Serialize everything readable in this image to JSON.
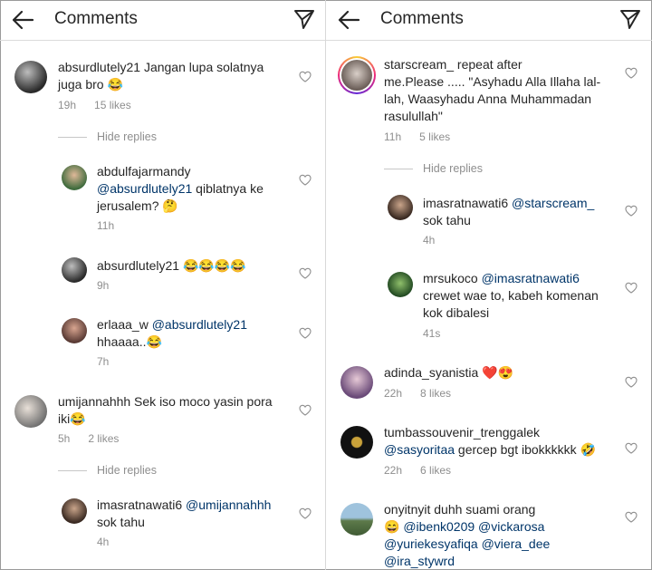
{
  "left": {
    "header": {
      "title": "Comments"
    },
    "comments": [
      {
        "id": "c1",
        "user": "absurdlutely21",
        "text_line1": " Jangan lupa solatnya",
        "text_line2": "juga bro 😂",
        "time": "19h",
        "likes": "15 likes"
      },
      {
        "id": "c1r1",
        "user": "abdulfajarmandy",
        "mention": "@absurdlutely21",
        "text_after_mention": " qiblatnya ke",
        "text_line3": "jerusalem? 🤔",
        "time": "11h"
      },
      {
        "id": "c1r2",
        "user": "absurdlutely21",
        "text": " 😂😂😂😂",
        "time": "9h"
      },
      {
        "id": "c1r3",
        "user": "erlaaa_w",
        "mention": "@absurdlutely21",
        "text_line2": "hhaaaa..😂",
        "time": "7h"
      },
      {
        "id": "c2",
        "user": "umijannahhh",
        "text_line1": " Sek iso moco yasin pora",
        "text_line2": "iki😂",
        "time": "5h",
        "likes": "2 likes"
      },
      {
        "id": "c2r1",
        "user": "imasratnawati6",
        "mention": "@umijannahhh",
        "text_line2": "sok tahu",
        "time": "4h"
      }
    ],
    "hide_replies": [
      "Hide replies",
      "Hide replies"
    ]
  },
  "right": {
    "header": {
      "title": "Comments"
    },
    "comments": [
      {
        "id": "r1",
        "user": "starscream_",
        "text_line1": " repeat after",
        "text_line2": "me.Please ..... \"Asyhadu Alla Illaha lal-",
        "text_line3": "lah, Waasyhadu Anna Muhammadan",
        "text_line4": "rasulullah\"",
        "time": "11h",
        "likes": "5 likes"
      },
      {
        "id": "r1r1",
        "user": "imasratnawati6",
        "mention": "@starscream_",
        "text_line2": "sok tahu",
        "time": "4h"
      },
      {
        "id": "r1r2",
        "user": "mrsukoco",
        "mention": "@imasratnawati6",
        "text_line2": "crewet wae to, kabeh komenan",
        "text_line3": "kok dibalesi",
        "time": "41s"
      },
      {
        "id": "r2",
        "user": "adinda_syanistia",
        "text": " ❤️😍",
        "time": "22h",
        "likes": "8 likes"
      },
      {
        "id": "r3",
        "user": "tumbassouvenir_trenggalek",
        "mention": "@sasyoritaa",
        "text_after_mention": " gercep bgt ibokkkkkk 🤣",
        "time": "22h",
        "likes": "6 likes"
      },
      {
        "id": "r4",
        "user": "onyitnyit",
        "text_line1": " duhh suami orang",
        "emoji_line2": "😄 ",
        "mention_a": "@ibenk0209",
        "mention_b": " @vickarosa",
        "mention_c": "@yuriekesyafiqa",
        "mention_d": " @viera_dee",
        "mention_e": "@ira_stywrd"
      }
    ],
    "hide_replies": [
      "Hide replies"
    ]
  },
  "icons": {
    "back": "arrow-left-icon",
    "send": "send-icon",
    "like": "heart-outline-icon"
  },
  "colors": {
    "mention": "#003569",
    "meta": "#8e8e8e",
    "text": "#262626"
  }
}
